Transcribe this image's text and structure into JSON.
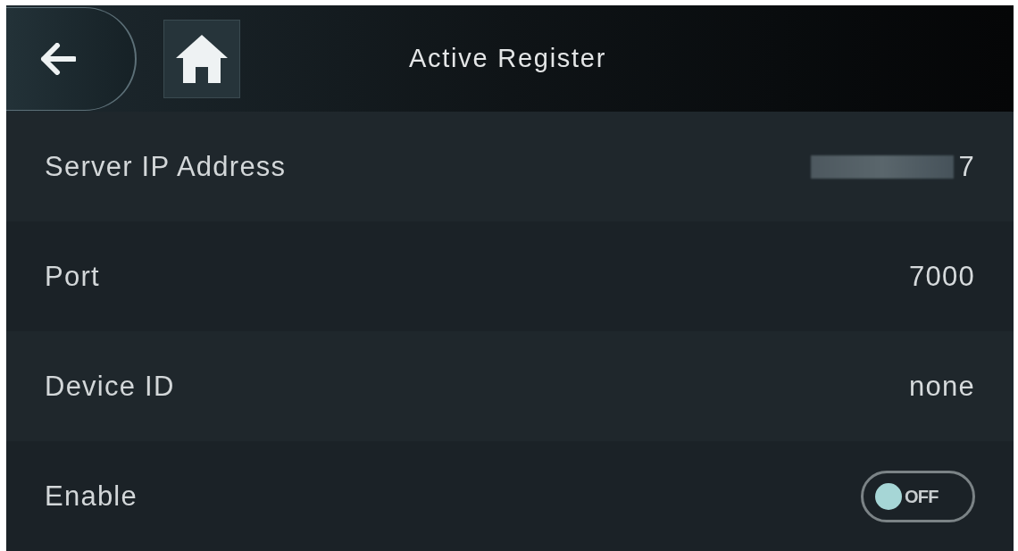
{
  "header": {
    "title": "Active Register"
  },
  "rows": [
    {
      "kind": "value",
      "label": "Server IP Address",
      "value": "7",
      "redacted": true
    },
    {
      "kind": "value",
      "label": "Port",
      "value": "7000",
      "redacted": false
    },
    {
      "kind": "value",
      "label": "Device ID",
      "value": "none",
      "redacted": false
    },
    {
      "kind": "toggle",
      "label": "Enable",
      "on": false,
      "state_label": "OFF"
    }
  ]
}
